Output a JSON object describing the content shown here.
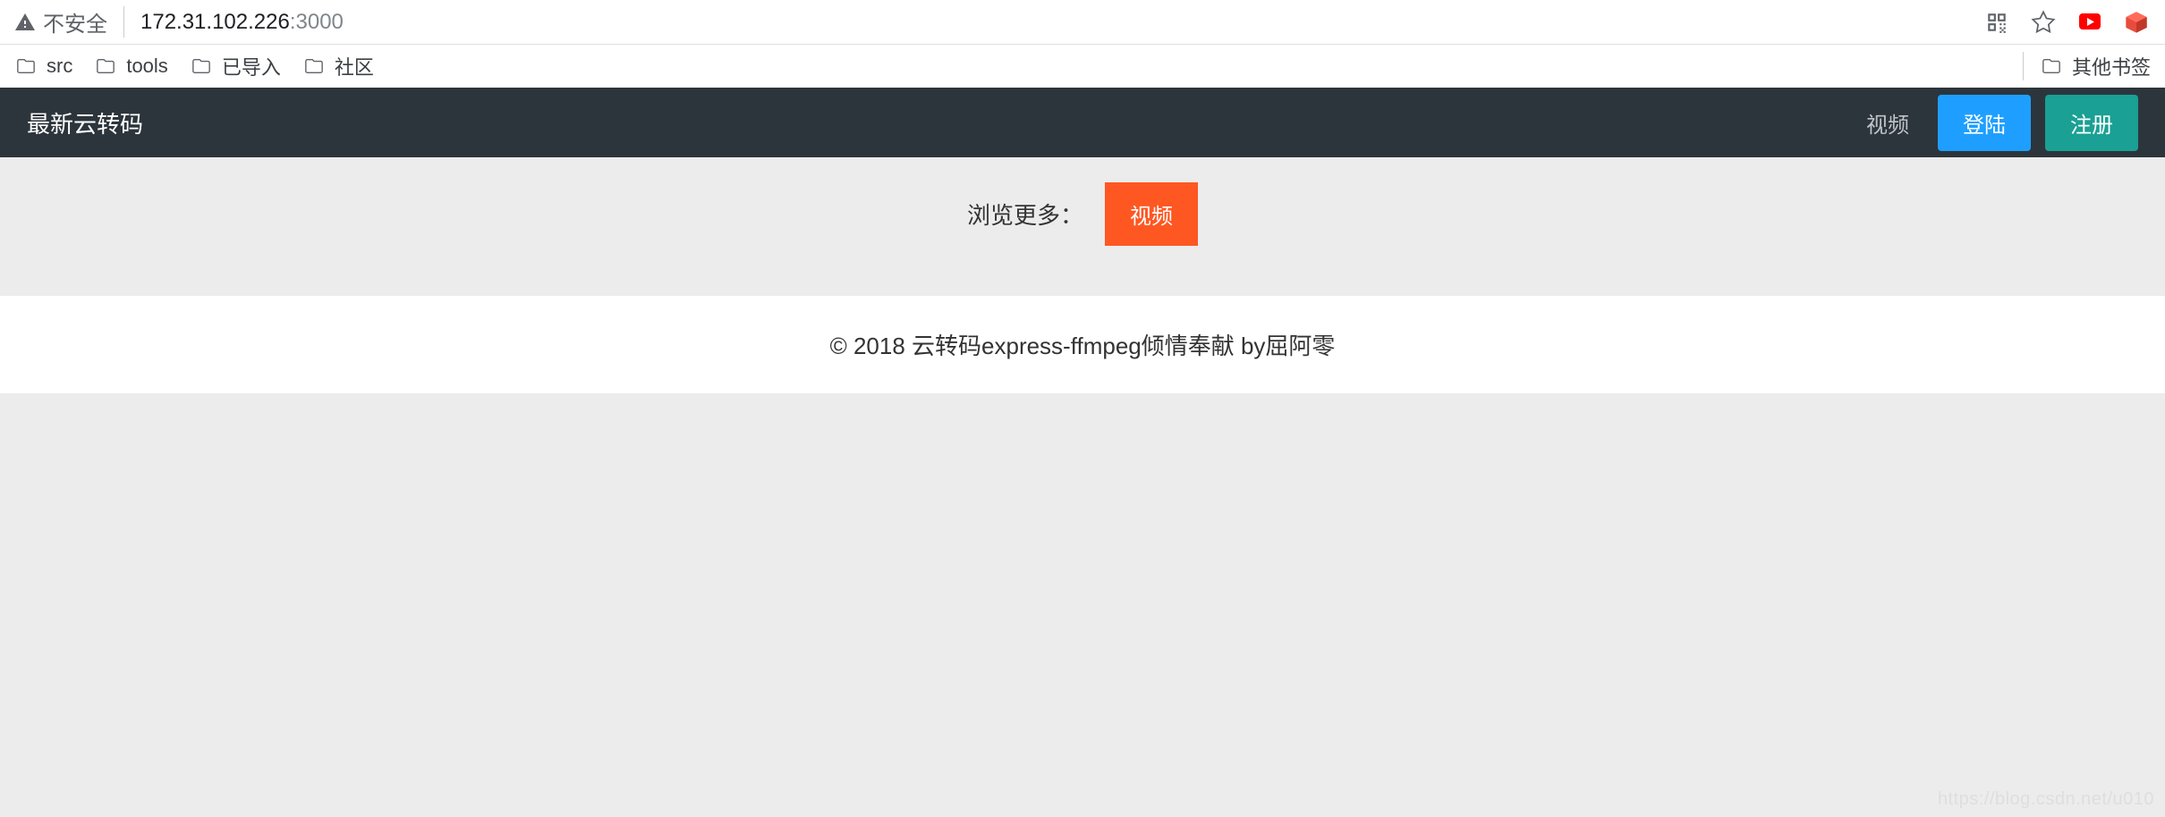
{
  "browser": {
    "security_label": "不安全",
    "url_host": "172.31.102.226",
    "url_port": ":3000"
  },
  "bookmarks": {
    "items": [
      {
        "label": "src"
      },
      {
        "label": "tools"
      },
      {
        "label": "已导入"
      },
      {
        "label": "社区"
      }
    ],
    "other_label": "其他书签"
  },
  "nav": {
    "title": "最新云转码",
    "video_link": "视频",
    "login_label": "登陆",
    "register_label": "注册"
  },
  "main": {
    "browse_label": "浏览更多：",
    "video_button": "视频"
  },
  "footer": {
    "text": "© 2018 云转码express-ffmpeg倾情奉献 by屈阿零"
  },
  "watermark": "https://blog.csdn.net/u010"
}
